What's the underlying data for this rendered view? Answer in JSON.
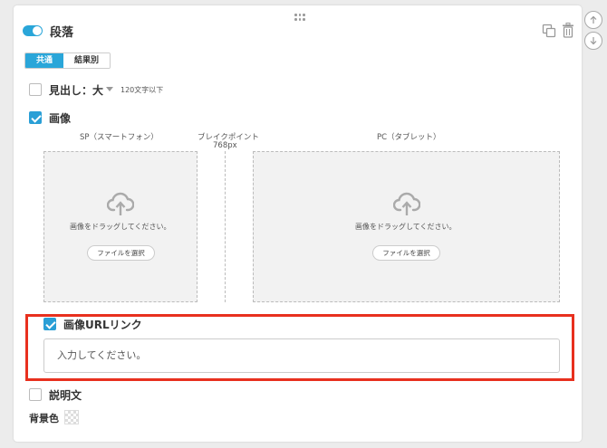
{
  "block": {
    "title": "段落",
    "enabled": true
  },
  "tabs": [
    {
      "label": "共通",
      "active": true
    },
    {
      "label": "結果別",
      "active": false
    }
  ],
  "heading": {
    "label": "見出し：大",
    "hint": "120文字以下",
    "checked": false
  },
  "image": {
    "label": "画像",
    "checked": true,
    "sp_label": "SP（スマートフォン）",
    "breakpoint_label": "ブレイクポイント",
    "breakpoint_value": "768px",
    "pc_label": "PC（タブレット）",
    "drop_text_sp": "画像をドラッグしてください。",
    "drop_text_pc": "画像をドラッグしてください。",
    "file_button_sp": "ファイルを選択",
    "file_button_pc": "ファイルを選択"
  },
  "image_url_link": {
    "label": "画像URLリンク",
    "checked": true,
    "placeholder": "入力してください。"
  },
  "description": {
    "label": "説明文",
    "checked": false
  },
  "background": {
    "label": "背景色"
  },
  "icons": {
    "drag": "drag-handle-icon",
    "copy": "copy-icon",
    "delete": "trash-icon",
    "move_up": "arrow-up-icon",
    "move_down": "arrow-down-icon",
    "upload": "cloud-upload-icon"
  },
  "colors": {
    "accent": "#2aa6d9",
    "highlight": "#e8301e"
  }
}
